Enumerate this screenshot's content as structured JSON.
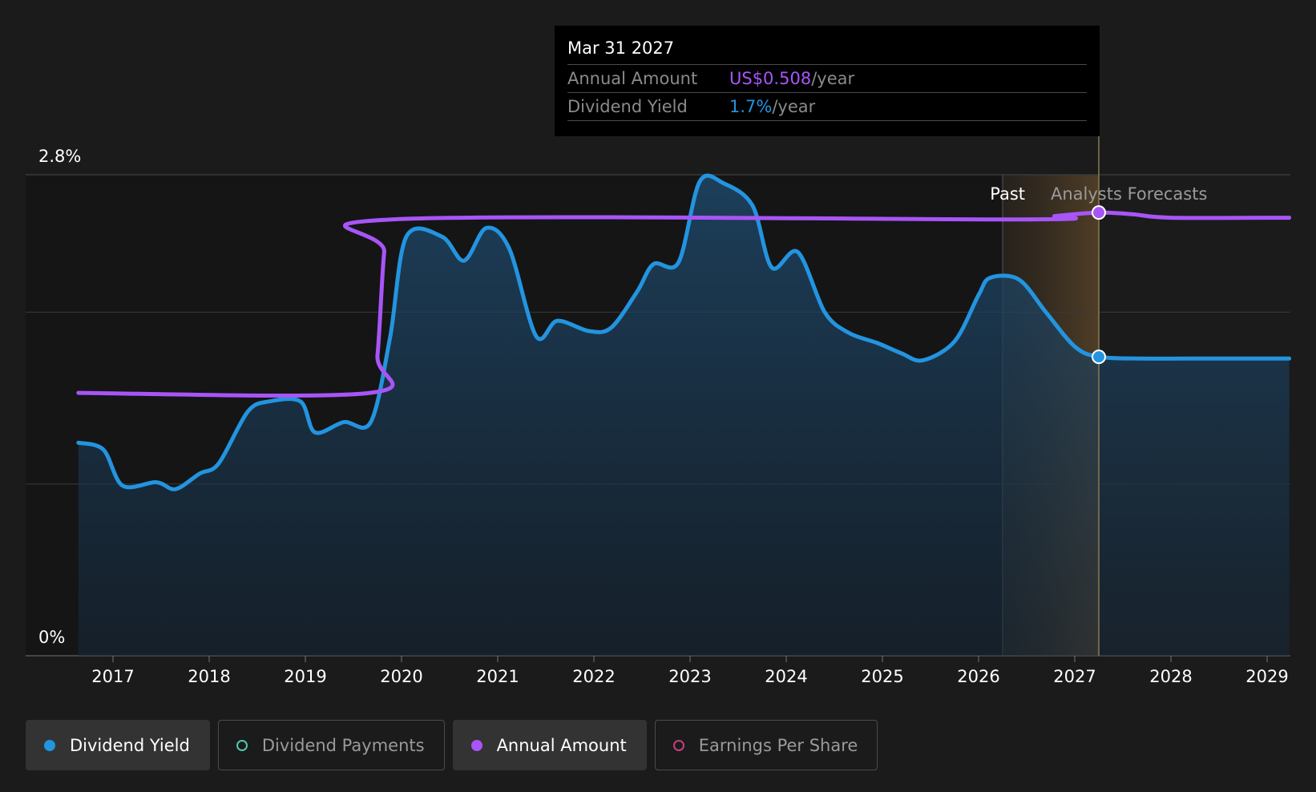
{
  "chart_data": {
    "type": "line",
    "y_axis": {
      "ticks": [
        "2.8%",
        "0%"
      ],
      "min": 0,
      "max": 2.8,
      "gridlines": [
        0,
        1,
        2,
        2.8
      ]
    },
    "x_axis": {
      "ticks": [
        "2017",
        "2018",
        "2019",
        "2020",
        "2021",
        "2022",
        "2023",
        "2024",
        "2025",
        "2026",
        "2027",
        "2028",
        "2029"
      ],
      "min": 2016.64,
      "max": 2029.23
    },
    "regions": {
      "past_label": "Past",
      "forecast_label": "Analysts Forecasts",
      "past_end": 2026.25,
      "forecast_start": 2026.6,
      "hover_x": 2027.25
    },
    "series": [
      {
        "name": "Dividend Yield",
        "color": "#2394df",
        "fill": true,
        "points": [
          [
            2016.64,
            1.24
          ],
          [
            2016.9,
            1.2
          ],
          [
            2017.1,
            0.99
          ],
          [
            2017.45,
            1.01
          ],
          [
            2017.65,
            0.97
          ],
          [
            2017.9,
            1.06
          ],
          [
            2018.1,
            1.12
          ],
          [
            2018.4,
            1.42
          ],
          [
            2018.62,
            1.48
          ],
          [
            2018.95,
            1.48
          ],
          [
            2019.1,
            1.3
          ],
          [
            2019.4,
            1.36
          ],
          [
            2019.68,
            1.36
          ],
          [
            2019.88,
            1.85
          ],
          [
            2020.05,
            2.44
          ],
          [
            2020.42,
            2.44
          ],
          [
            2020.65,
            2.3
          ],
          [
            2020.88,
            2.49
          ],
          [
            2021.12,
            2.37
          ],
          [
            2021.4,
            1.86
          ],
          [
            2021.62,
            1.95
          ],
          [
            2021.95,
            1.89
          ],
          [
            2022.18,
            1.91
          ],
          [
            2022.45,
            2.12
          ],
          [
            2022.62,
            2.28
          ],
          [
            2022.88,
            2.29
          ],
          [
            2023.1,
            2.76
          ],
          [
            2023.35,
            2.75
          ],
          [
            2023.65,
            2.62
          ],
          [
            2023.85,
            2.26
          ],
          [
            2024.12,
            2.35
          ],
          [
            2024.4,
            2.0
          ],
          [
            2024.65,
            1.88
          ],
          [
            2024.95,
            1.82
          ],
          [
            2025.2,
            1.76
          ],
          [
            2025.42,
            1.72
          ],
          [
            2025.75,
            1.83
          ],
          [
            2026.0,
            2.1
          ],
          [
            2026.12,
            2.2
          ],
          [
            2026.42,
            2.19
          ],
          [
            2026.7,
            2.0
          ],
          [
            2027.0,
            1.8
          ],
          [
            2027.25,
            1.74
          ],
          [
            2027.7,
            1.73
          ],
          [
            2028.2,
            1.73
          ],
          [
            2029.23,
            1.73
          ]
        ]
      },
      {
        "name": "Annual Amount",
        "color": "#a855f7",
        "fill": false,
        "points": [
          [
            2016.64,
            1.53
          ],
          [
            2019.67,
            1.53
          ],
          [
            2019.75,
            1.75
          ],
          [
            2019.82,
            2.35
          ],
          [
            2019.9,
            2.54
          ],
          [
            2026.45,
            2.54
          ],
          [
            2026.8,
            2.56
          ],
          [
            2027.25,
            2.58
          ],
          [
            2027.6,
            2.57
          ],
          [
            2028.0,
            2.55
          ],
          [
            2029.23,
            2.55
          ]
        ]
      }
    ],
    "hover_points": [
      {
        "series": "Annual Amount",
        "x": 2027.25,
        "y": 2.58
      },
      {
        "series": "Dividend Yield",
        "x": 2027.25,
        "y": 1.74
      }
    ]
  },
  "tooltip": {
    "date": "Mar 31 2027",
    "rows": [
      {
        "label": "Annual Amount",
        "value": "US$0.508",
        "unit": "/year",
        "color": "#a855f7"
      },
      {
        "label": "Dividend Yield",
        "value": "1.7%",
        "unit": "/year",
        "color": "#2394df"
      }
    ]
  },
  "legend": [
    {
      "label": "Dividend Yield",
      "color": "#2394df",
      "active": true
    },
    {
      "label": "Dividend Payments",
      "color": "#4ec9b0",
      "active": false
    },
    {
      "label": "Annual Amount",
      "color": "#a855f7",
      "active": true
    },
    {
      "label": "Earnings Per Share",
      "color": "#c2407c",
      "active": false
    }
  ]
}
